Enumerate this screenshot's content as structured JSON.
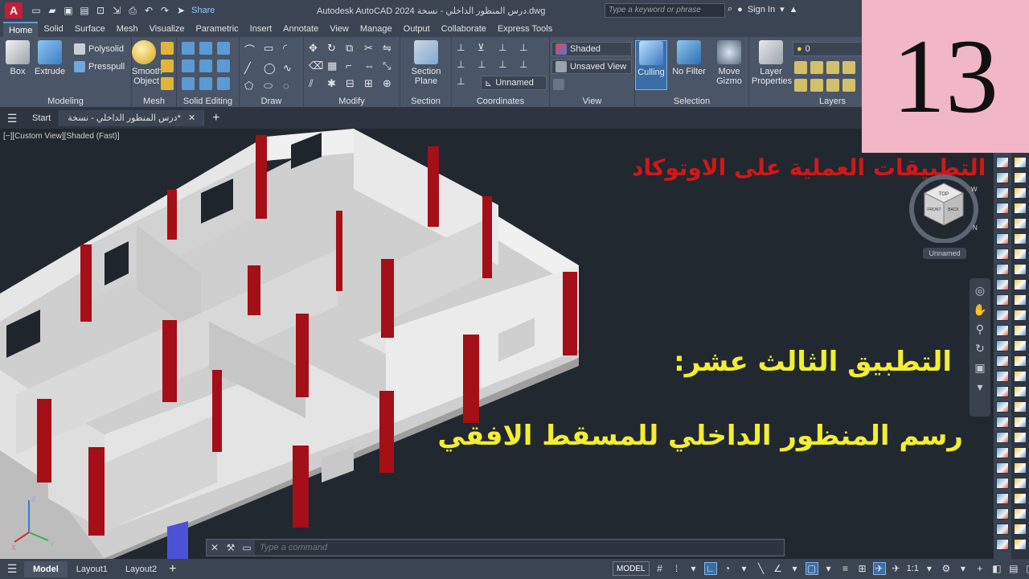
{
  "titlebar": {
    "app_letter": "A",
    "share_label": "Share",
    "window_title": "Autodesk AutoCAD 2024   درس المنظور الداخلي - نسخة.dwg",
    "search_placeholder": "Type a keyword or phrase",
    "signin_label": "Sign In"
  },
  "ribbon_tabs": [
    "Home",
    "Solid",
    "Surface",
    "Mesh",
    "Visualize",
    "Parametric",
    "Insert",
    "Annotate",
    "View",
    "Manage",
    "Output",
    "Collaborate",
    "Express Tools"
  ],
  "ribbon": {
    "modeling": {
      "label": "Modeling",
      "box": "Box",
      "extrude": "Extrude",
      "polysolid": "Polysolid",
      "presspull": "Presspull"
    },
    "mesh": {
      "label": "Mesh",
      "smooth_object": "Smooth Object"
    },
    "solid_editing": {
      "label": "Solid Editing"
    },
    "draw": {
      "label": "Draw"
    },
    "modify": {
      "label": "Modify"
    },
    "section": {
      "label": "Section",
      "section_plane": "Section Plane"
    },
    "coordinates": {
      "label": "Coordinates",
      "ucs_name": "Unnamed"
    },
    "view": {
      "label": "View",
      "visual_style": "Shaded",
      "named_view": "Unsaved View"
    },
    "selection": {
      "label": "Selection",
      "culling": "Culling",
      "no_filter": "No Filter",
      "move_gizmo": "Move Gizmo"
    },
    "layers": {
      "label": "Layers",
      "layer_properties": "Layer Properties",
      "current_layer": "0"
    }
  },
  "file_tabs": {
    "start": "Start",
    "drawing": "درس المنظور الداخلي - نسخة*"
  },
  "viewport": {
    "label": "[−][Custom View][Shaded (Fast)]",
    "viewcube_ucs": "Unnamed",
    "cube_top": "TOP",
    "cube_front": "FRONT",
    "cube_back": "BACK",
    "compass_w": "W",
    "compass_n": "N",
    "ucs_x": "X",
    "ucs_y": "Y",
    "ucs_z": "Z"
  },
  "overlay": {
    "series_title": "سلسلة التطبيقات العملية على الاوتوكاد",
    "lesson_line1": "التطبيق الثالث عشر:",
    "lesson_line2": "رسم المنظور الداخلي للمسقط الافقي",
    "lesson_number": "13"
  },
  "command_line": {
    "placeholder": "Type a command"
  },
  "status": {
    "model_tab": "Model",
    "layout1": "Layout1",
    "layout2": "Layout2",
    "model_button": "MODEL",
    "scale": "1:1"
  },
  "colors": {
    "wall": "#d8d8d8",
    "column": "#a50f17",
    "accent": "#5b9bd5",
    "badge": "#f2b7c6"
  }
}
